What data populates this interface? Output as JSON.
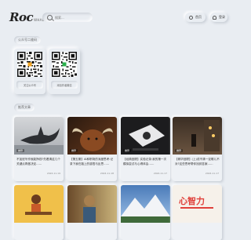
{
  "header": {
    "logo_main": "Roc",
    "logo_sub": "WHALE",
    "search_placeholder": "搜索...",
    "home_label": "首页",
    "login_label": "登录"
  },
  "sections": {
    "wechat_title": "公众号二维码",
    "recommend_title": "推荐文章"
  },
  "qr_cards": [
    {
      "caption": "关注公众号"
    },
    {
      "caption": "添加作者微信"
    }
  ],
  "articles": [
    {
      "tag": "推荐",
      "title": "不加班写作就能挣钱?先看清这几个关键点再做决定……",
      "date": "2024.11.19"
    },
    {
      "tag": "推荐",
      "title": "【第五期】AI和职场的深度思考:记录下我在路上的感悟与反思……",
      "date": "2024.11.18"
    },
    {
      "tag": "推荐",
      "title": "【经典回顾】实验记录:我的第一次模拟尝试与心得体会……",
      "date": "2024.11.17"
    },
    {
      "tag": "推荐",
      "title": "【精华回顾】(上)说不清一定哪儿不对?这些思考帮你找到答案……",
      "date": "2024.11.17"
    },
    {
      "tag": "",
      "title": "",
      "date": ""
    },
    {
      "tag": "",
      "title": "",
      "date": ""
    },
    {
      "tag": "",
      "title": "",
      "date": ""
    },
    {
      "tag": "",
      "title": "心智力",
      "date": ""
    }
  ]
}
